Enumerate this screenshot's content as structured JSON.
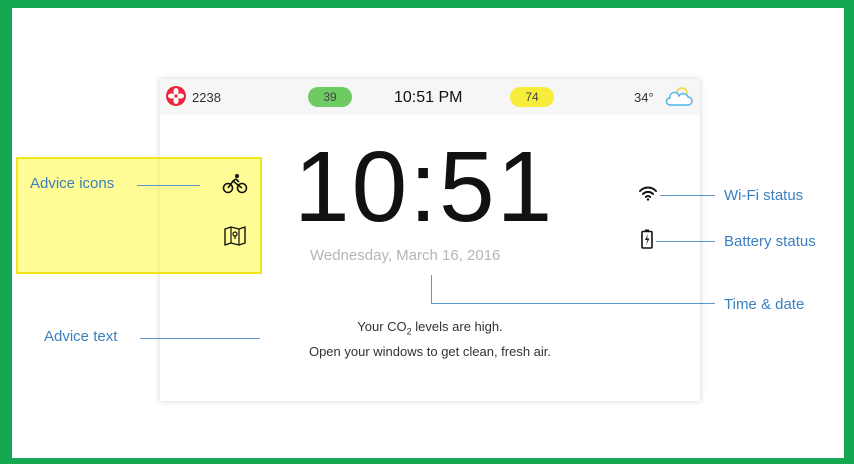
{
  "status_bar": {
    "co2_count": "2238",
    "green_badge": "39",
    "time": "10:51 PM",
    "yellow_badge": "74",
    "temperature": "34°"
  },
  "clock": {
    "time": "10:51",
    "date": "Wednesday, March 16, 2016"
  },
  "advice": {
    "line1_before": "Your CO",
    "line1_sub": "2",
    "line1_after": " levels are high.",
    "line2": "Open your windows to get clean, fresh air."
  },
  "callouts": {
    "advice_icons": "Advice icons",
    "advice_text": "Advice text",
    "wifi_status": "Wi-Fi status",
    "battery_status": "Battery status",
    "time_date": "Time & date"
  },
  "colors": {
    "frame": "#14a850",
    "highlight": "#f7f03a",
    "callout": "#3a7fc0",
    "fan": "#e8273c",
    "green_badge": "#6ecb63",
    "yellow_badge": "#f7ec3a"
  },
  "icons": [
    "fan-icon",
    "partly-cloudy-icon",
    "bicycle-icon",
    "map-icon",
    "wifi-icon",
    "battery-icon"
  ]
}
